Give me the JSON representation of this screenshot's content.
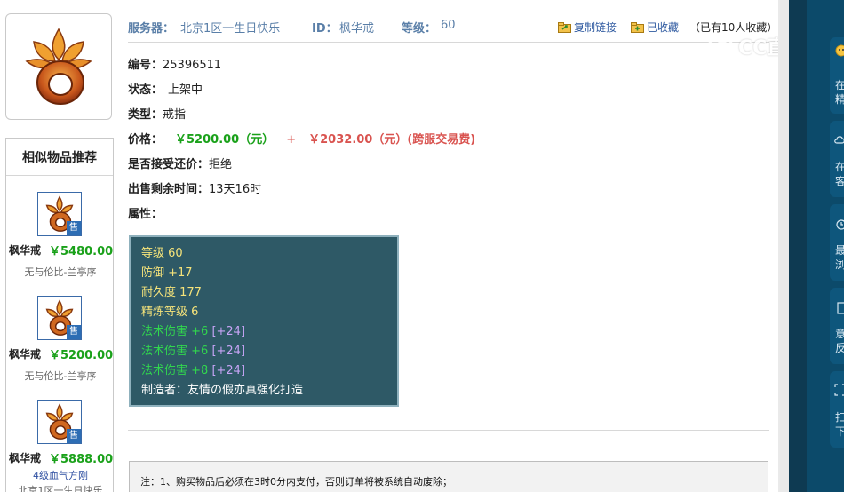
{
  "header": {
    "server_label": "服务器：",
    "server_value": "北京1区一生日快乐",
    "id_label": "ID：",
    "id_value": "枫华戒",
    "level_label": "等级：",
    "level_value": "60",
    "copy_link": "复制链接",
    "favorited": "已收藏",
    "favorite_count": "（已有10人收藏）"
  },
  "fields": {
    "number_label": "编号：",
    "number_value": "25396511",
    "status_label": "状态：",
    "status_value": "上架中",
    "type_label": "类型：",
    "type_value": "戒指",
    "price_label": "价格：",
    "price_main": "￥5200.00（元）",
    "price_plus": "+",
    "price_fee": "￥2032.00（元）(跨服交易费)",
    "bargain_label": "是否接受还价：",
    "bargain_value": "拒绝",
    "remaining_label": "出售剩余时间：",
    "remaining_value": "13天16时",
    "attributes_label": "属性："
  },
  "attributes": {
    "level": "等级 60",
    "defense": "防御 +17",
    "durability": "耐久度 177",
    "refine": "精炼等级 6",
    "magic1": "法术伤害 +6",
    "magic1_bonus": "[+24]",
    "magic2": "法术伤害 +6",
    "magic2_bonus": "[+24]",
    "magic3": "法术伤害 +8",
    "magic3_bonus": "[+24]",
    "maker": "制造者：友情の假亦真强化打造"
  },
  "similar": {
    "title": "相似物品推荐",
    "sale_badge": "售",
    "items": [
      {
        "name": "枫华戒",
        "price": "￥5480.00",
        "sub": "无与伦比-兰亭序"
      },
      {
        "name": "枫华戒",
        "price": "￥5200.00",
        "sub": "无与伦比-兰亭序"
      },
      {
        "name": "枫华戒",
        "price": "￥5888.00",
        "sub": "4级血气方刚",
        "sub2": "北京1区一生日快乐"
      }
    ]
  },
  "note": "注：1、购买物品后必须在3时0分内支付，否则订单将被系统自动废除；",
  "watermark": "CC直播",
  "right_panel": {
    "item1": "在精",
    "item2": "在客",
    "item3": "最浏",
    "item4": "意反",
    "item5": "扫下"
  },
  "colors": {
    "label_blue": "#5a7fa8",
    "price_green": "#1aa11a",
    "price_red": "#d9534f",
    "panel_bg": "#2e5966"
  }
}
